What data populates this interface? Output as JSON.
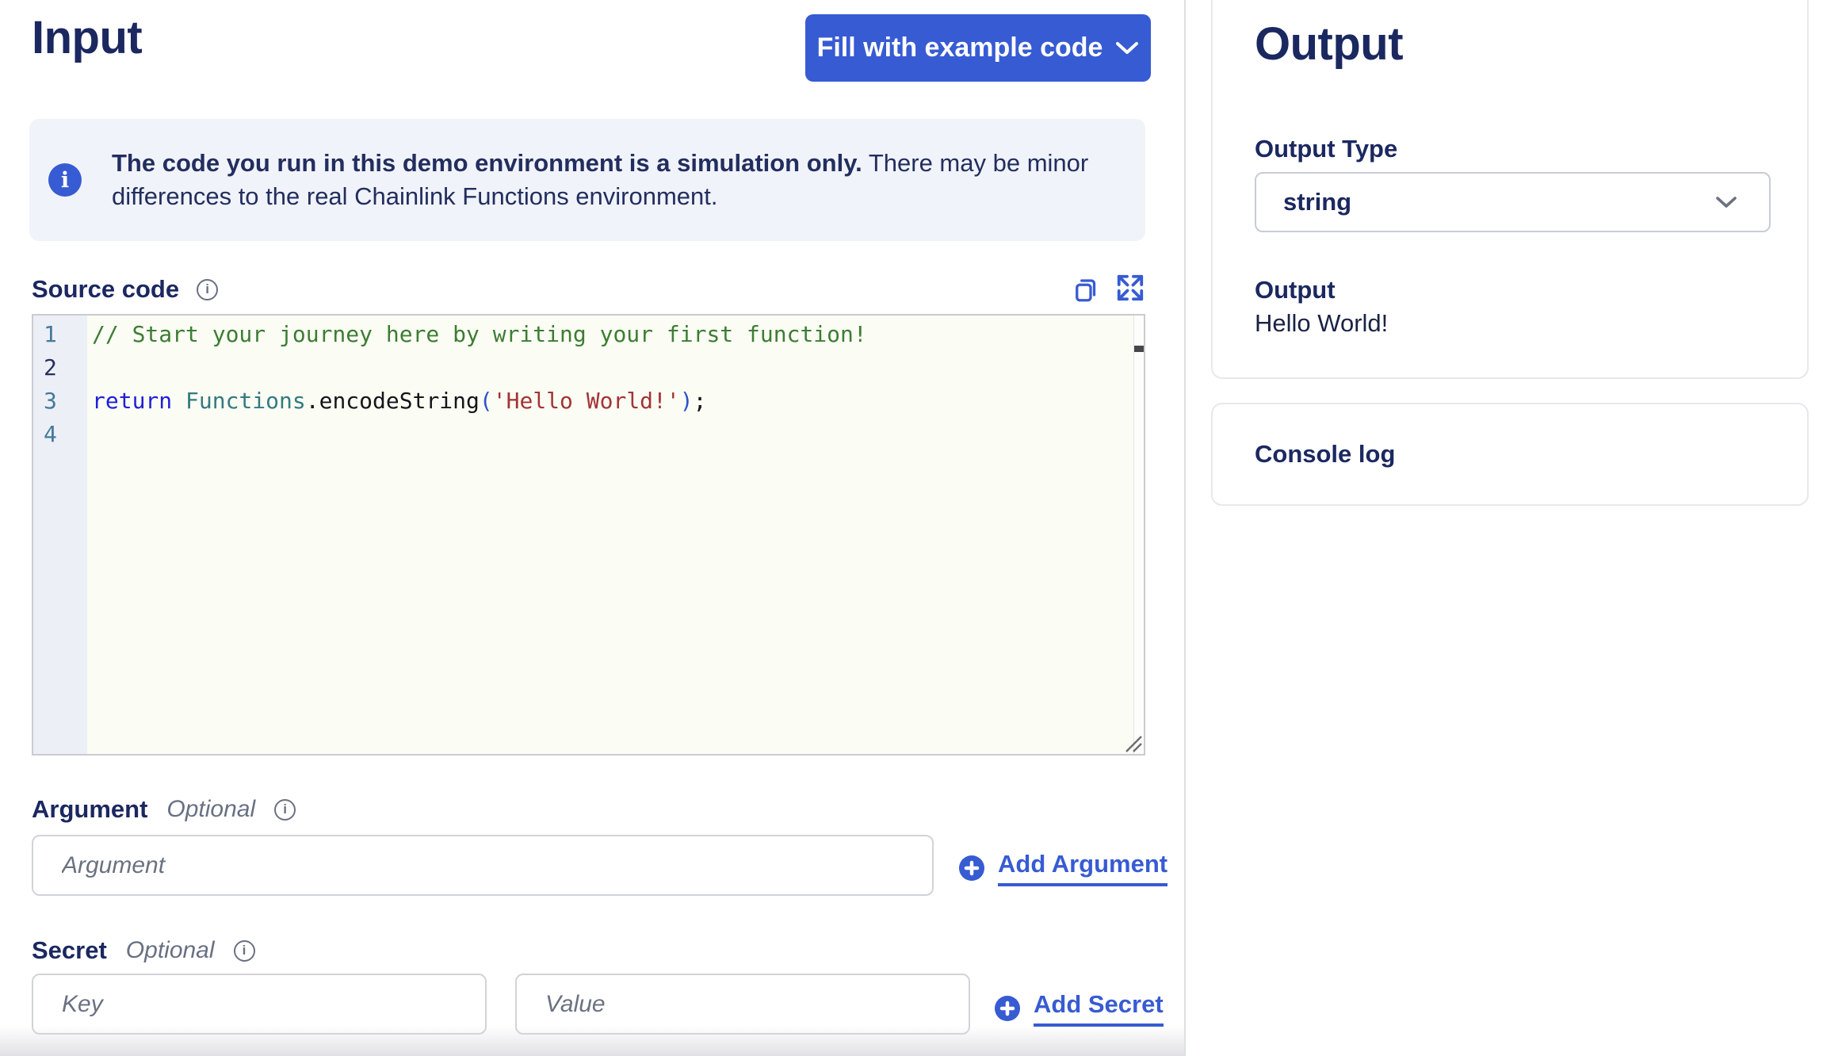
{
  "input": {
    "title": "Input",
    "fill_button_label": "Fill with example code",
    "banner": {
      "bold_text": "The code you run in this demo environment is a simulation only.",
      "regular_text": " There may be minor differences to the real Chainlink Functions environment."
    },
    "source_label": "Source code",
    "code": {
      "lines": [
        {
          "n": "1",
          "tokens": [
            {
              "t": "// Start your journey here by writing your first function!"
            }
          ]
        },
        {
          "n": "2",
          "tokens": []
        },
        {
          "n": "3",
          "tokens": [
            {
              "t": "return"
            },
            {
              "t": " "
            },
            {
              "t": "Functions"
            },
            {
              "t": ".encodeString"
            },
            {
              "t": "("
            },
            {
              "t": "'Hello World!'"
            },
            {
              "t": ")"
            },
            {
              "t": ";"
            }
          ]
        },
        {
          "n": "4",
          "tokens": []
        }
      ]
    },
    "argument": {
      "label": "Argument",
      "optional": "Optional",
      "placeholder": "Argument",
      "add_label": "Add Argument"
    },
    "secret": {
      "label": "Secret",
      "optional": "Optional",
      "key_placeholder": "Key",
      "value_placeholder": "Value",
      "add_label": "Add Secret"
    }
  },
  "output": {
    "title": "Output",
    "type_label": "Output Type",
    "type_value": "string",
    "result_label": "Output",
    "result_value": "Hello World!",
    "console_label": "Console log"
  },
  "icons": {
    "info_glyph": "i"
  },
  "colors": {
    "brand_blue": "#375bd2",
    "heading_navy": "#1b2860",
    "code_comment_green": "#3c7d33",
    "code_keyword_blue": "#1f1fd8",
    "code_class_teal": "#337a80",
    "code_bracket_blue": "#2d52c8",
    "code_string_red": "#a33434"
  }
}
